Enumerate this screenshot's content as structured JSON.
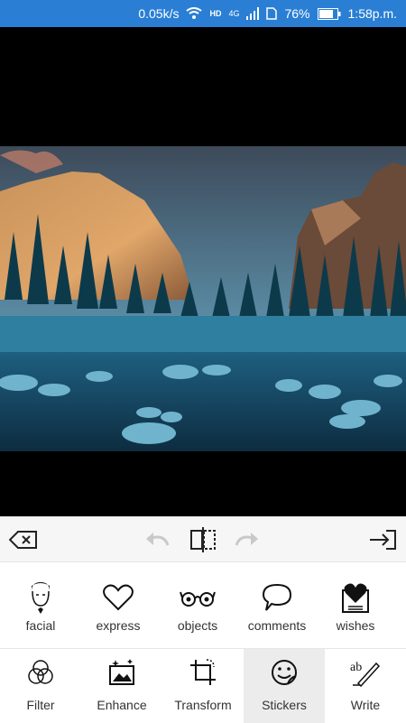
{
  "status_bar": {
    "network_speed": "0.05k/s",
    "hd_label": "HD",
    "network_type": "4G",
    "battery": "76%",
    "time": "1:58p.m."
  },
  "toolbar": {
    "icons": [
      "backspace-icon",
      "undo-icon",
      "compare-icon",
      "redo-icon",
      "export-icon"
    ]
  },
  "stickers": {
    "items": [
      {
        "label": "facial",
        "icon": "face-icon"
      },
      {
        "label": "express",
        "icon": "heart-outline-icon"
      },
      {
        "label": "objects",
        "icon": "glasses-icon"
      },
      {
        "label": "comments",
        "icon": "speech-bubble-icon"
      },
      {
        "label": "wishes",
        "icon": "heart-card-icon"
      }
    ]
  },
  "bottom_nav": {
    "items": [
      {
        "label": "Filter",
        "icon": "filter-circles-icon"
      },
      {
        "label": "Enhance",
        "icon": "enhance-image-icon"
      },
      {
        "label": "Transform",
        "icon": "crop-icon"
      },
      {
        "label": "Stickers",
        "icon": "sticker-face-icon",
        "active": true
      },
      {
        "label": "Write",
        "icon": "write-pen-icon"
      }
    ]
  },
  "colors": {
    "status_bar": "#2a7fd4",
    "active_tab_bg": "#ececec",
    "icon": "#222222"
  }
}
